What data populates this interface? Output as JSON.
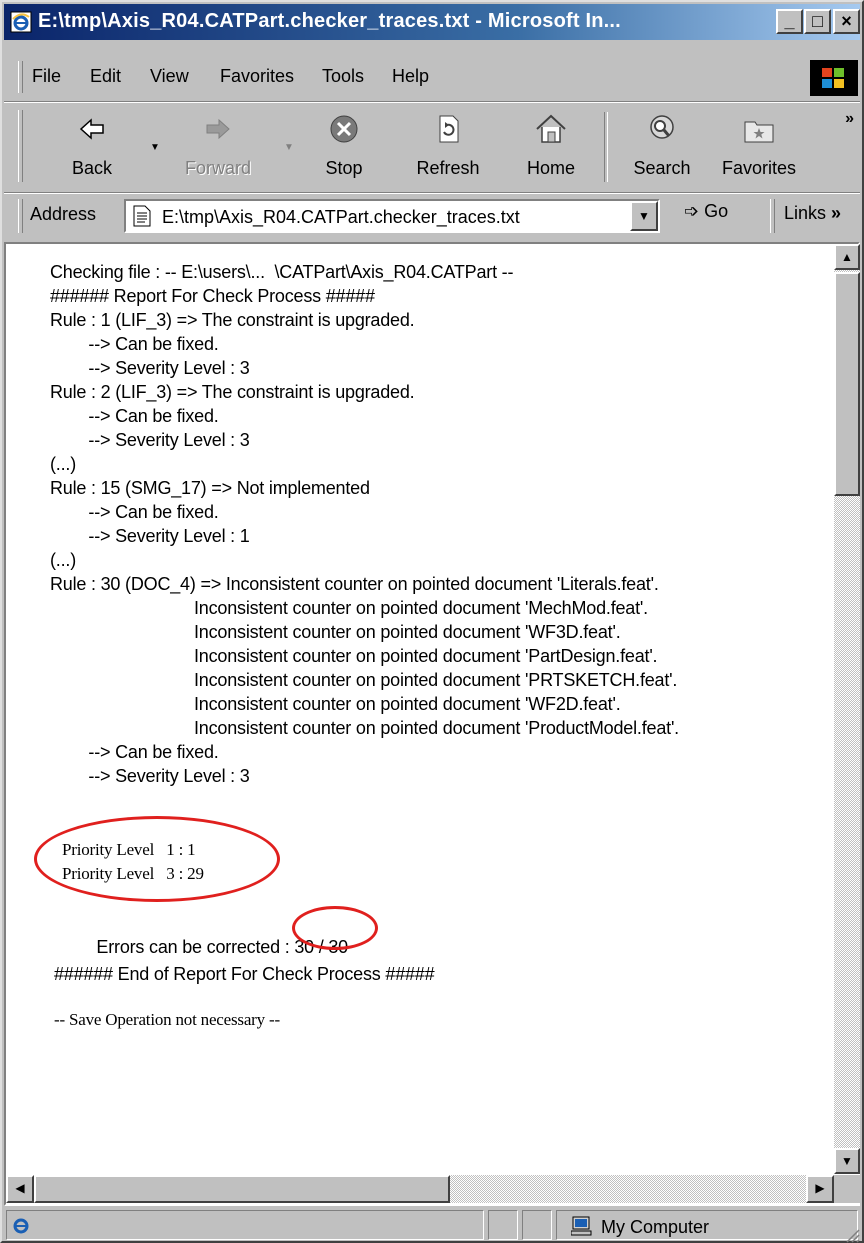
{
  "window": {
    "title": "E:\\tmp\\Axis_R04.CATPart.checker_traces.txt - Microsoft In...",
    "controls": {
      "minimize": "_",
      "maximize": "□",
      "close": "×"
    }
  },
  "menu": [
    "File",
    "Edit",
    "View",
    "Favorites",
    "Tools",
    "Help"
  ],
  "toolbar": {
    "back": "Back",
    "forward": "Forward",
    "stop": "Stop",
    "refresh": "Refresh",
    "home": "Home",
    "search": "Search",
    "favorites": "Favorites",
    "more": "»"
  },
  "address": {
    "label": "Address",
    "value": "E:\\tmp\\Axis_R04.CATPart.checker_traces.txt",
    "go": "Go",
    "links": "Links"
  },
  "report": {
    "lines": [
      "Checking file : -- E:\\users\\...  \\CATPart\\Axis_R04.CATPart --",
      "###### Report For Check Process #####",
      "Rule : 1 (LIF_3) => The constraint is upgraded.",
      "        --> Can be fixed.",
      "        --> Severity Level : 3",
      "Rule : 2 (LIF_3) => The constraint is upgraded.",
      "        --> Can be fixed.",
      "        --> Severity Level : 3",
      "(...)",
      "Rule : 15 (SMG_17) => Not implemented",
      "        --> Can be fixed.",
      "        --> Severity Level : 1",
      "(...)",
      "Rule : 30 (DOC_4) => Inconsistent counter on pointed document 'Literals.feat'.",
      "Inconsistent counter on pointed document 'MechMod.feat'.",
      "Inconsistent counter on pointed document 'WF3D.feat'.",
      "Inconsistent counter on pointed document 'PartDesign.feat'.",
      "Inconsistent counter on pointed document 'PRTSKETCH.feat'.",
      "Inconsistent counter on pointed document 'WF2D.feat'.",
      "Inconsistent counter on pointed document 'ProductModel.feat'.",
      "        --> Can be fixed.",
      "        --> Severity Level : 3"
    ],
    "priority_1": "Priority Level   1 : 1",
    "priority_3": "Priority Level   3 : 29",
    "errors_label": "Errors can be corrected : ",
    "errors_value": "30 / 30",
    "end": "###### End of Report For Check Process #####",
    "save": "-- Save Operation not necessary --"
  },
  "status": {
    "zone": "My Computer"
  },
  "colors": {
    "titlebar_start": "#0a246a",
    "titlebar_end": "#a6caf0",
    "annotation": "#e0201e",
    "chrome": "#c0c0c0"
  }
}
